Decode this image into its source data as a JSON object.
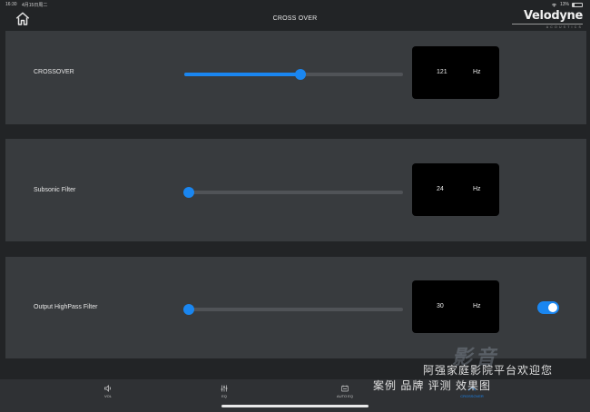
{
  "status": {
    "time": "16:30",
    "date": "4月15日周二",
    "battery": "13%"
  },
  "header": {
    "title": "CROSS OVER",
    "brand": "Velodyne",
    "brand_sub": "ACOUSTICS"
  },
  "panels": [
    {
      "label": "CROSSOVER",
      "slider_fraction": 0.53,
      "value": "121",
      "unit": "Hz"
    },
    {
      "label": "Subsonic Filter",
      "slider_fraction": 0.02,
      "value": "24",
      "unit": "Hz"
    },
    {
      "label": "Output HighPass Filter",
      "slider_fraction": 0.02,
      "value": "30",
      "unit": "Hz",
      "toggle_on": true
    }
  ],
  "tabs": [
    {
      "label": "VOL",
      "icon": "speaker-icon"
    },
    {
      "label": "EQ",
      "icon": "equalizer-icon"
    },
    {
      "label": "AUTO EQ",
      "icon": "auto-eq-icon"
    },
    {
      "label": "CROSSOVER",
      "icon": "crossover-icon",
      "active": true
    }
  ],
  "watermark": {
    "line1": "阿强家庭影院平台欢迎您",
    "line2": "案例 品牌 评测 效果图",
    "ghost": "影音"
  },
  "colors": {
    "accent": "#1a86f0",
    "panel": "#383b3e",
    "background": "#222426"
  }
}
